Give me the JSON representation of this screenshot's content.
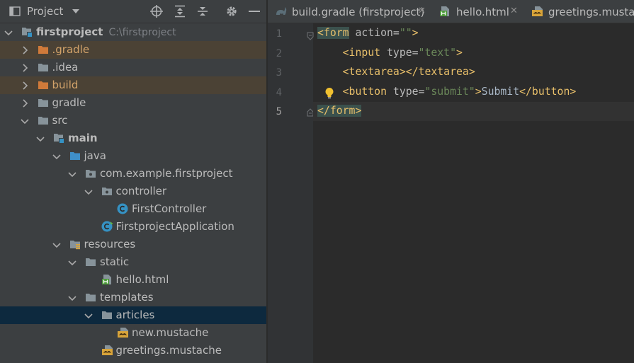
{
  "project_panel": {
    "title": "Project",
    "header_icons": [
      "locate-icon",
      "expand-all-icon",
      "collapse-all-icon",
      "gear-icon",
      "minimize-icon"
    ]
  },
  "tree": [
    {
      "label": "firstproject",
      "path": "C:\\firstproject",
      "bold": true,
      "icon": "module-folder-icon",
      "expanded": true
    },
    {
      "label": ".gradle",
      "icon": "excluded-folder-icon",
      "expanded": false,
      "highlighted": true
    },
    {
      "label": ".idea",
      "icon": "folder-icon",
      "expanded": false
    },
    {
      "label": "build",
      "icon": "excluded-folder-icon",
      "expanded": false,
      "highlighted": true
    },
    {
      "label": "gradle",
      "icon": "folder-icon",
      "expanded": false
    },
    {
      "label": "src",
      "icon": "folder-icon",
      "expanded": true
    },
    {
      "label": "main",
      "bold": true,
      "icon": "module-folder-icon",
      "expanded": true
    },
    {
      "label": "java",
      "icon": "source-folder-icon",
      "expanded": true
    },
    {
      "label": "com.example.firstproject",
      "icon": "package-icon",
      "expanded": true
    },
    {
      "label": "controller",
      "icon": "package-icon",
      "expanded": true
    },
    {
      "label": "FirstController",
      "icon": "class-icon"
    },
    {
      "label": "FirstprojectApplication",
      "icon": "spring-boot-class-icon"
    },
    {
      "label": "resources",
      "icon": "resources-folder-icon",
      "expanded": true
    },
    {
      "label": "static",
      "icon": "folder-icon",
      "expanded": true
    },
    {
      "label": "hello.html",
      "icon": "html-file-icon"
    },
    {
      "label": "templates",
      "icon": "folder-icon",
      "expanded": true
    },
    {
      "label": "articles",
      "icon": "folder-icon",
      "expanded": true,
      "selected": true
    },
    {
      "label": "new.mustache",
      "icon": "mustache-file-icon"
    },
    {
      "label": "greetings.mustache",
      "icon": "mustache-file-icon"
    }
  ],
  "tabs": [
    {
      "label": "build.gradle (firstproject)",
      "icon": "gradle-icon",
      "close": "✕"
    },
    {
      "label": "hello.html",
      "icon": "html-file-icon",
      "close": "✕"
    },
    {
      "label": "greetings.mustache",
      "icon": "mustache-file-icon"
    }
  ],
  "editor": {
    "line_numbers": [
      "1",
      "2",
      "3",
      "4",
      "5"
    ],
    "current_line": 5,
    "lines": [
      {
        "indent": "",
        "tokens": [
          [
            "<form",
            "tag"
          ],
          [
            " action=",
            "attr"
          ],
          [
            "\"\"",
            "str"
          ],
          [
            ">",
            "tag"
          ]
        ]
      },
      {
        "indent": "    ",
        "tokens": [
          [
            "<input",
            "tag"
          ],
          [
            " type=",
            "attr"
          ],
          [
            "\"text\"",
            "str"
          ],
          [
            ">",
            "tag"
          ]
        ]
      },
      {
        "indent": "    ",
        "tokens": [
          [
            "<textarea>",
            "tag"
          ],
          [
            "</textarea>",
            "tag"
          ]
        ]
      },
      {
        "indent": "    ",
        "tokens": [
          [
            "<button",
            "tag"
          ],
          [
            " type=",
            "attr"
          ],
          [
            "\"submit\"",
            "str"
          ],
          [
            ">",
            "tag"
          ],
          [
            "Submit",
            "txt"
          ],
          [
            "</button>",
            "tag"
          ]
        ]
      },
      {
        "indent": "",
        "tokens": [
          [
            "</form>",
            "tag"
          ]
        ]
      }
    ]
  }
}
